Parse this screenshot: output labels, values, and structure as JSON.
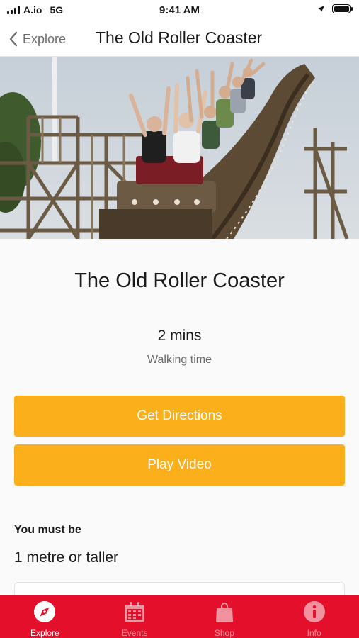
{
  "status_bar": {
    "carrier": "A.io",
    "network": "5G",
    "time": "9:41 AM",
    "location_icon": "location-arrow-icon",
    "battery_level": 1.0
  },
  "nav": {
    "back_label": "Explore",
    "title": "The Old Roller Coaster"
  },
  "hero": {
    "image_alt": "Riders with raised arms on a wooden roller coaster"
  },
  "attraction": {
    "title": "The Old Roller Coaster",
    "walking_time_value": "2 mins",
    "walking_time_label": "Walking time"
  },
  "actions": {
    "directions_label": "Get Directions",
    "video_label": "Play Video"
  },
  "requirements": {
    "heading": "You must be",
    "value": "1 metre or taller"
  },
  "tabs": [
    {
      "label": "Explore",
      "icon": "compass-icon",
      "active": true
    },
    {
      "label": "Events",
      "icon": "calendar-icon",
      "active": false
    },
    {
      "label": "Shop",
      "icon": "shopping-bag-icon",
      "active": false
    },
    {
      "label": "Info",
      "icon": "info-icon",
      "active": false
    }
  ],
  "colors": {
    "accent": "#fbaf1a",
    "tab_bar": "#e30f2b",
    "background": "#fafafa"
  }
}
